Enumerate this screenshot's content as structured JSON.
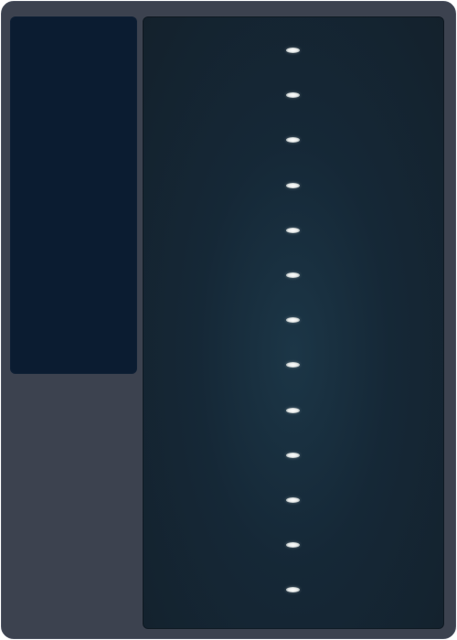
{
  "window": {
    "background_color": "#3c424f",
    "left_panel_color": "#0b1c31",
    "right_panel_color": "#17232e"
  },
  "track": {
    "marker_color": "#e8ebea",
    "marker_count": 13
  }
}
